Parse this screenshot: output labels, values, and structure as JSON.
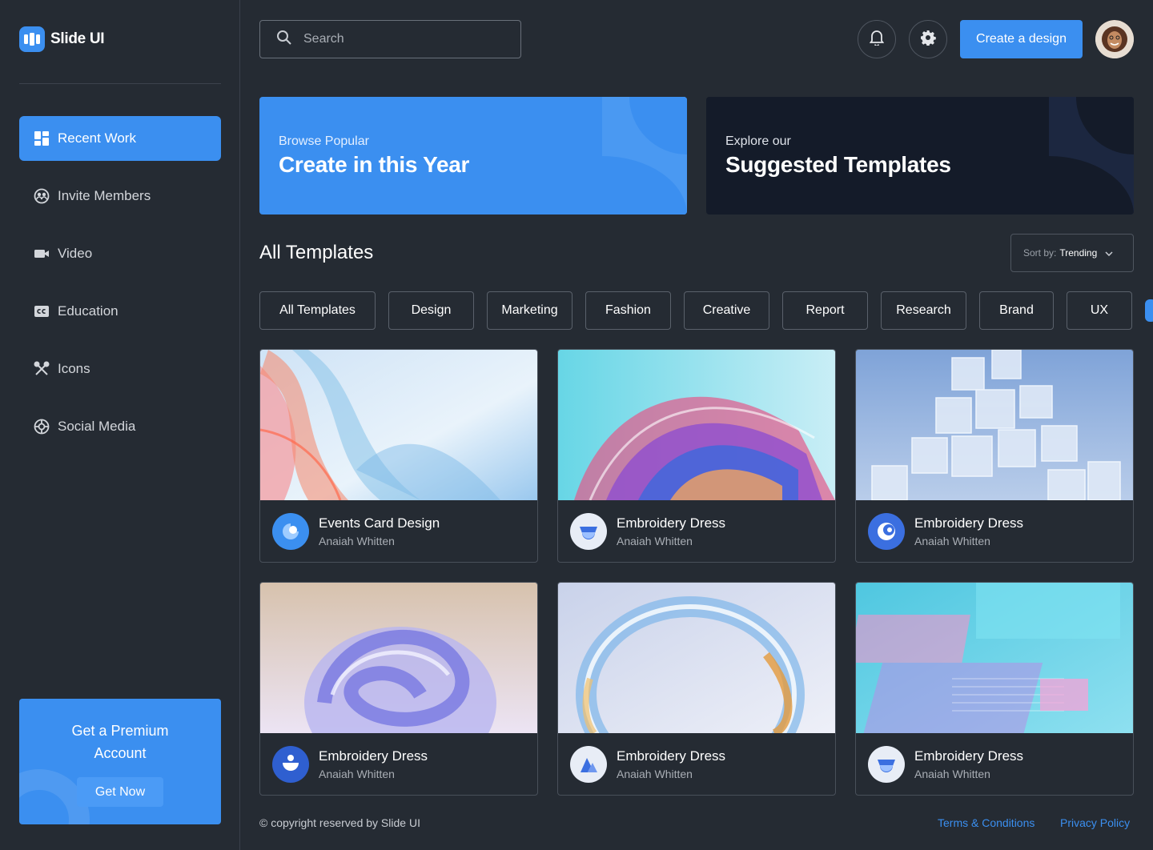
{
  "brand": {
    "name": "Slide UI",
    "logo_icon": "slides-logo-icon"
  },
  "sidebar": {
    "items": [
      {
        "label": "Recent Work",
        "icon": "dashboard-icon",
        "active": true
      },
      {
        "label": "Invite Members",
        "icon": "users-icon",
        "active": false
      },
      {
        "label": "Video",
        "icon": "video-camera-icon",
        "active": false
      },
      {
        "label": "Education",
        "icon": "closed-caption-icon",
        "active": false
      },
      {
        "label": "Icons",
        "icon": "tools-icon",
        "active": false
      },
      {
        "label": "Social Media",
        "icon": "globe-icon",
        "active": false
      }
    ],
    "promo": {
      "title": "Get a Premium Account",
      "button": "Get Now"
    }
  },
  "header": {
    "search_placeholder": "Search",
    "create_button": "Create a design",
    "notification_icon": "bell-icon",
    "settings_icon": "gear-icon"
  },
  "banners": [
    {
      "subtitle": "Browse Popular",
      "title": "Create in this Year",
      "theme": "#3b8ff0"
    },
    {
      "subtitle": "Explore our",
      "title": "Suggested Templates",
      "theme": "#141b29"
    }
  ],
  "templates": {
    "title": "All Templates",
    "sort_label": "Sort by:",
    "sort_value": "Trending",
    "categories": [
      "All Templates",
      "Design",
      "Marketing",
      "Fashion",
      "Creative",
      "Report",
      "Research",
      "Brand",
      "UX"
    ],
    "cards": [
      {
        "title": "Events Card Design",
        "author": "Anaiah Whitten"
      },
      {
        "title": "Embroidery Dress",
        "author": "Anaiah Whitten"
      },
      {
        "title": "Embroidery Dress",
        "author": "Anaiah Whitten"
      },
      {
        "title": "Embroidery Dress",
        "author": "Anaiah Whitten"
      },
      {
        "title": "Embroidery Dress",
        "author": "Anaiah Whitten"
      },
      {
        "title": "Embroidery Dress",
        "author": "Anaiah Whitten"
      }
    ]
  },
  "footer": {
    "copyright": "© copyright reserved by Slide UI",
    "links": [
      "Terms & Conditions",
      "Privacy Policy"
    ]
  },
  "colors": {
    "accent": "#3b8ff0",
    "background": "#252b33",
    "dark_banner": "#141b29"
  }
}
